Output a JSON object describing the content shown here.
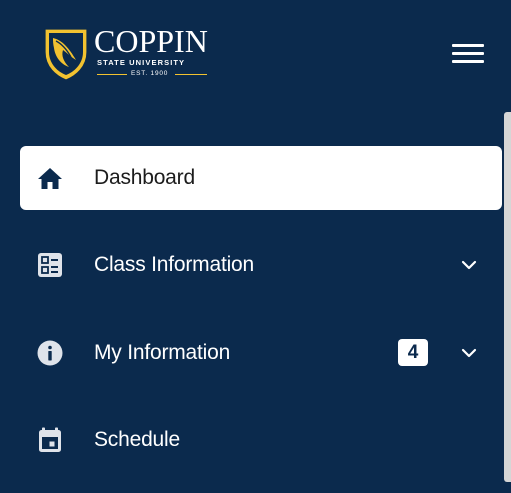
{
  "brand": {
    "name": "COPPIN",
    "subtitle": "STATE UNIVERSITY",
    "est": "EST. 1900",
    "logo_icon": "coppin-shield-logo",
    "colors": {
      "navy": "#0b2a4d",
      "gold": "#f2c230",
      "white": "#ffffff"
    }
  },
  "header": {
    "menu_icon": "hamburger-menu-icon"
  },
  "nav": {
    "items": [
      {
        "label": "Dashboard",
        "icon": "home-icon",
        "active": true
      },
      {
        "label": "Class Information",
        "icon": "class-list-icon",
        "expandable": true
      },
      {
        "label": "My Information",
        "icon": "info-icon",
        "badge": "4",
        "expandable": true
      },
      {
        "label": "Schedule",
        "icon": "calendar-icon"
      }
    ]
  }
}
